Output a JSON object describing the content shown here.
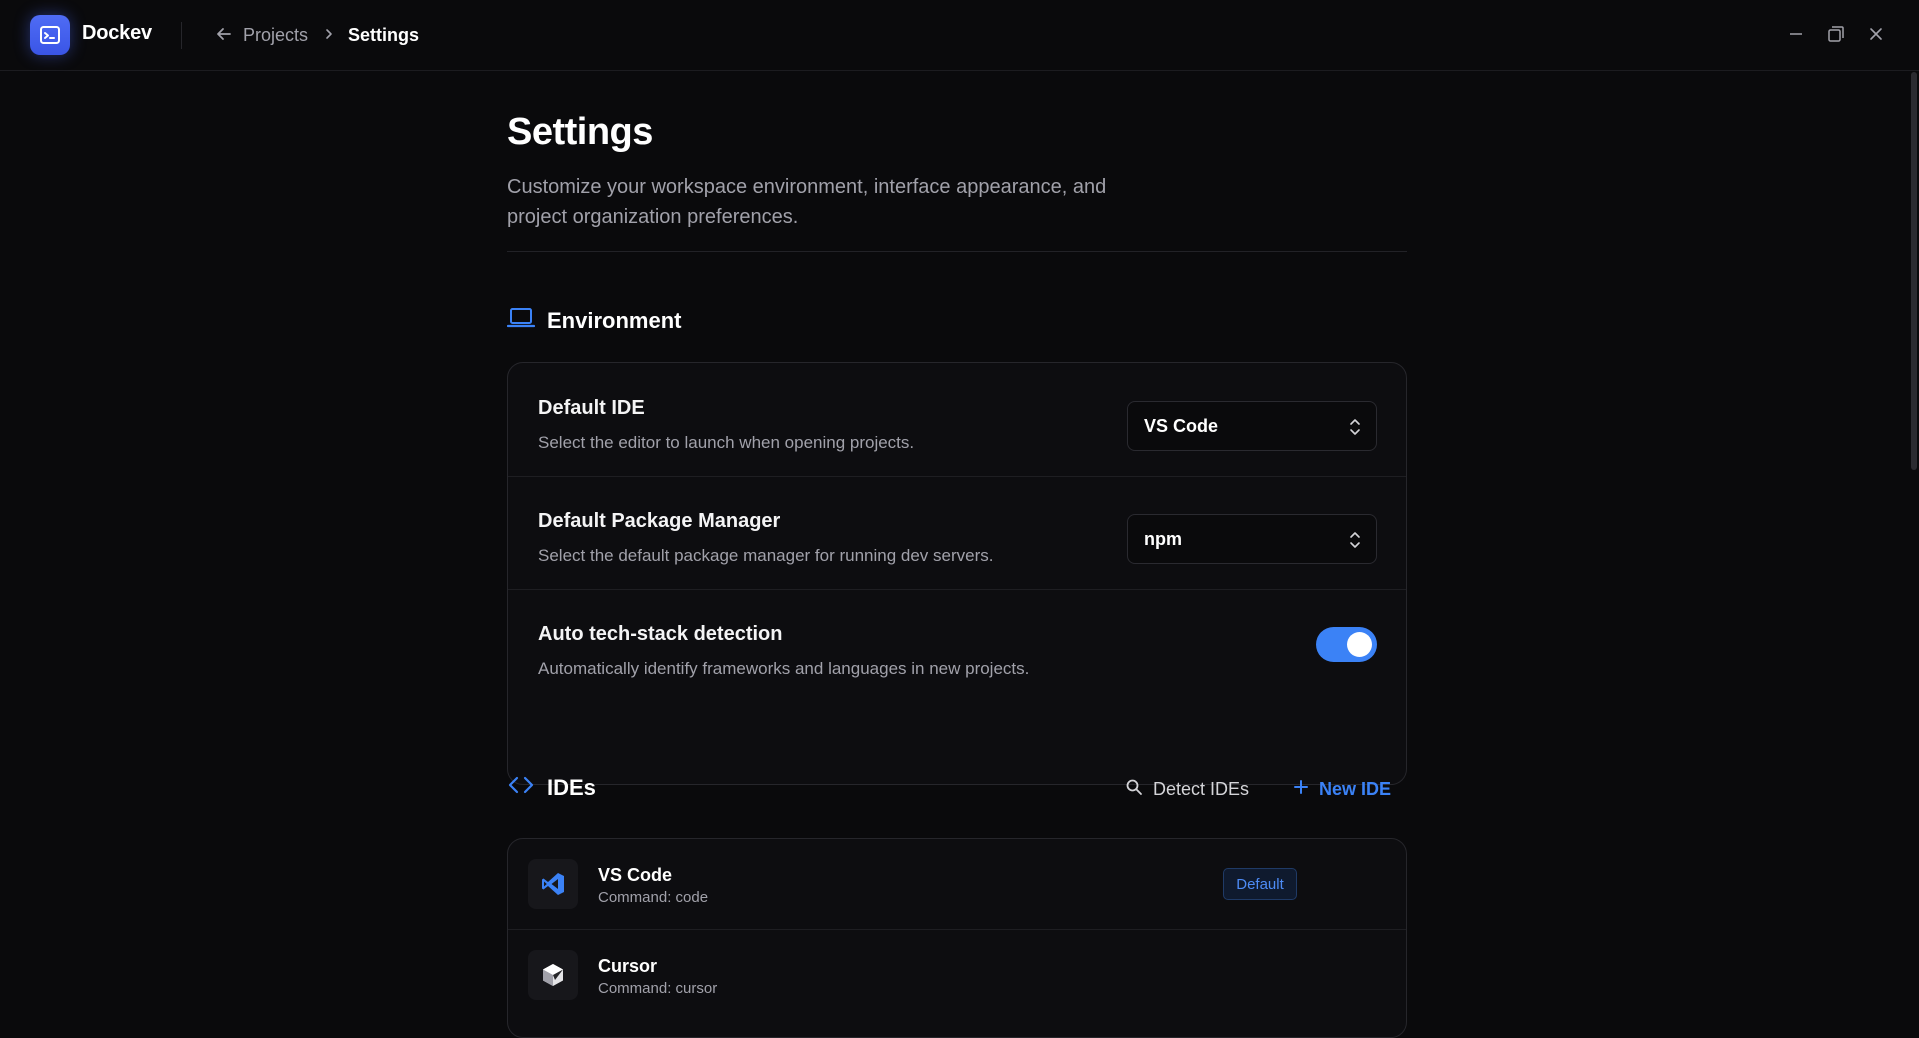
{
  "app": {
    "name": "Dockev"
  },
  "breadcrumb": {
    "projects": "Projects",
    "current": "Settings"
  },
  "header": {
    "title": "Settings",
    "description": "Customize your workspace environment, interface appearance, and project organization preferences."
  },
  "environment": {
    "title": "Environment",
    "default_ide": {
      "title": "Default IDE",
      "description": "Select the editor to launch when opening projects.",
      "value": "VS Code"
    },
    "package_manager": {
      "title": "Default Package Manager",
      "description": "Select the default package manager for running dev servers.",
      "value": "npm"
    },
    "auto_detect": {
      "title": "Auto tech-stack detection",
      "description": "Automatically identify frameworks and languages in new projects.",
      "enabled": true
    }
  },
  "ides": {
    "title": "IDEs",
    "detect_label": "Detect IDEs",
    "new_label": "New IDE",
    "items": [
      {
        "name": "VS Code",
        "command": "Command: code",
        "badge": "Default",
        "icon": "vscode-icon"
      },
      {
        "name": "Cursor",
        "command": "Command: cursor",
        "icon": "cursor-icon"
      }
    ]
  },
  "colors": {
    "accent": "#3b82f6",
    "logo": "#4563ee",
    "background": "#0a0a0c"
  }
}
